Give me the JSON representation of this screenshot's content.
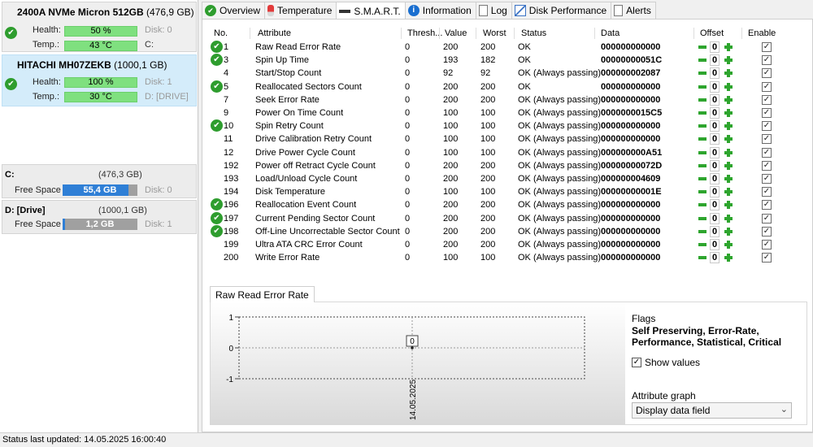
{
  "disks": [
    {
      "model": "2400A NVMe Micron 512GB",
      "size": "(476,9 GB)",
      "health_label": "Health:",
      "health": "50 %",
      "health_pct": 50,
      "disk_index": "Disk: 0",
      "temp_label": "Temp.:",
      "temp": "43 °C",
      "drive": "C:"
    },
    {
      "model": "HITACHI MH07ZEKB",
      "size": "(1000,1 GB)",
      "health_label": "Health:",
      "health": "100 %",
      "health_pct": 100,
      "disk_index": "Disk: 1",
      "temp_label": "Temp.:",
      "temp": "30 °C",
      "drive": "D: [DRIVE]"
    }
  ],
  "volumes": [
    {
      "name": "C:",
      "size": "(476,3 GB)",
      "free_label": "Free Space",
      "free": "55,4 GB",
      "used_fraction": 0.88,
      "disk": "Disk: 0"
    },
    {
      "name": "D: [Drive]",
      "size": "(1000,1 GB)",
      "free_label": "Free Space",
      "free": "1,2 GB",
      "used_fraction": 0.03,
      "disk": "Disk: 1"
    }
  ],
  "tabs": [
    "Overview",
    "Temperature",
    "S.M.A.R.T.",
    "Information",
    "Log",
    "Disk Performance",
    "Alerts"
  ],
  "columns": [
    "No.",
    "Attribute",
    "Thresh...",
    "Value",
    "Worst",
    "Status",
    "Data",
    "Offset",
    "Enable"
  ],
  "rows": [
    {
      "no": "1",
      "attr": "Raw Read Error Rate",
      "thresh": "0",
      "value": "200",
      "worst": "200",
      "status": "OK",
      "data": "000000000000",
      "offset": "0",
      "ok": true
    },
    {
      "no": "3",
      "attr": "Spin Up Time",
      "thresh": "0",
      "value": "193",
      "worst": "182",
      "status": "OK",
      "data": "00000000051C",
      "offset": "0",
      "ok": true
    },
    {
      "no": "4",
      "attr": "Start/Stop Count",
      "thresh": "0",
      "value": "92",
      "worst": "92",
      "status": "OK (Always passing)",
      "data": "000000002087",
      "offset": "0",
      "ok": false
    },
    {
      "no": "5",
      "attr": "Reallocated Sectors Count",
      "thresh": "0",
      "value": "200",
      "worst": "200",
      "status": "OK",
      "data": "000000000000",
      "offset": "0",
      "ok": true
    },
    {
      "no": "7",
      "attr": "Seek Error Rate",
      "thresh": "0",
      "value": "200",
      "worst": "200",
      "status": "OK (Always passing)",
      "data": "000000000000",
      "offset": "0",
      "ok": false
    },
    {
      "no": "9",
      "attr": "Power On Time Count",
      "thresh": "0",
      "value": "100",
      "worst": "100",
      "status": "OK (Always passing)",
      "data": "0000000015C5",
      "offset": "0",
      "ok": false
    },
    {
      "no": "10",
      "attr": "Spin Retry Count",
      "thresh": "0",
      "value": "100",
      "worst": "100",
      "status": "OK (Always passing)",
      "data": "000000000000",
      "offset": "0",
      "ok": true
    },
    {
      "no": "11",
      "attr": "Drive Calibration Retry Count",
      "thresh": "0",
      "value": "100",
      "worst": "100",
      "status": "OK (Always passing)",
      "data": "000000000000",
      "offset": "0",
      "ok": false
    },
    {
      "no": "12",
      "attr": "Drive Power Cycle Count",
      "thresh": "0",
      "value": "100",
      "worst": "100",
      "status": "OK (Always passing)",
      "data": "000000000A51",
      "offset": "0",
      "ok": false
    },
    {
      "no": "192",
      "attr": "Power off Retract Cycle Count",
      "thresh": "0",
      "value": "200",
      "worst": "200",
      "status": "OK (Always passing)",
      "data": "00000000072D",
      "offset": "0",
      "ok": false
    },
    {
      "no": "193",
      "attr": "Load/Unload Cycle Count",
      "thresh": "0",
      "value": "200",
      "worst": "200",
      "status": "OK (Always passing)",
      "data": "000000004609",
      "offset": "0",
      "ok": false
    },
    {
      "no": "194",
      "attr": "Disk Temperature",
      "thresh": "0",
      "value": "100",
      "worst": "100",
      "status": "OK (Always passing)",
      "data": "00000000001E",
      "offset": "0",
      "ok": false
    },
    {
      "no": "196",
      "attr": "Reallocation Event Count",
      "thresh": "0",
      "value": "200",
      "worst": "200",
      "status": "OK (Always passing)",
      "data": "000000000000",
      "offset": "0",
      "ok": true
    },
    {
      "no": "197",
      "attr": "Current Pending Sector Count",
      "thresh": "0",
      "value": "200",
      "worst": "200",
      "status": "OK (Always passing)",
      "data": "000000000000",
      "offset": "0",
      "ok": true
    },
    {
      "no": "198",
      "attr": "Off-Line Uncorrectable Sector Count",
      "thresh": "0",
      "value": "200",
      "worst": "200",
      "status": "OK (Always passing)",
      "data": "000000000000",
      "offset": "0",
      "ok": true
    },
    {
      "no": "199",
      "attr": "Ultra ATA CRC Error Count",
      "thresh": "0",
      "value": "200",
      "worst": "200",
      "status": "OK (Always passing)",
      "data": "000000000000",
      "offset": "0",
      "ok": false
    },
    {
      "no": "200",
      "attr": "Write Error Rate",
      "thresh": "0",
      "value": "100",
      "worst": "100",
      "status": "OK (Always passing)",
      "data": "000000000000",
      "offset": "0",
      "ok": false
    }
  ],
  "graph": {
    "tab": "Raw Read Error Rate",
    "y_ticks": [
      "1",
      "0",
      "-1"
    ],
    "point_label": "0",
    "date_label": "14.05.2025"
  },
  "flags": {
    "title": "Flags",
    "text": "Self Preserving, Error-Rate, Performance, Statistical, Critical"
  },
  "show_values_label": "Show values",
  "attribute_graph_label": "Attribute graph",
  "attribute_graph_value": "Display data field",
  "status_bar": "Status last updated: 14.05.2025 16:00:40",
  "icons": {
    "ok": "check-circle-icon",
    "offset_minus": "minus-icon",
    "offset_plus": "plus-icon"
  }
}
